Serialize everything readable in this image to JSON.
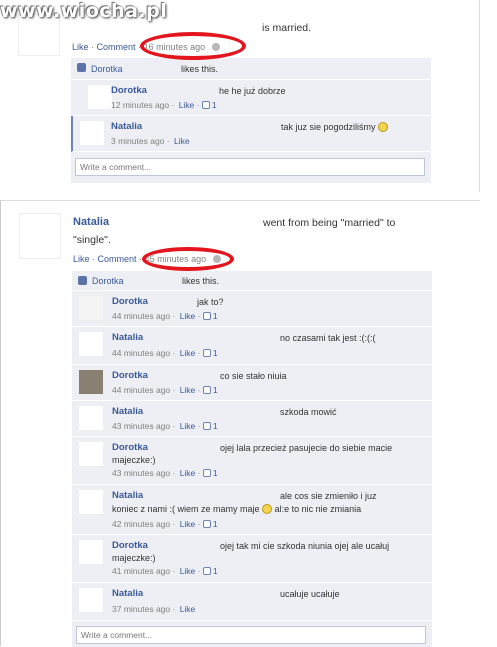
{
  "watermark": "www.wiocha.pl",
  "post1": {
    "action": "is married.",
    "actions": {
      "like": "Like",
      "comment": "Comment",
      "time": "16 minutes ago"
    },
    "likes_name": "Dorotka",
    "likes_text": "likes this.",
    "comments": [
      {
        "name": "Dorotka",
        "text": "he he już dobrze",
        "time": "12 minutes ago",
        "like": "Like",
        "count": "1"
      },
      {
        "name": "Natalia",
        "text": "tak juz sie pogodziliśmy",
        "time": "3 minutes ago",
        "like": "Like"
      }
    ],
    "write_placeholder": "Write a comment..."
  },
  "post2": {
    "name": "Natalia",
    "action_line1": "went from being \"married\" to",
    "action_line2": "\"single\".",
    "actions": {
      "like": "Like",
      "comment": "Comment",
      "time": "45 minutes ago"
    },
    "likes_name": "Dorotka",
    "likes_text": "likes this.",
    "comments": [
      {
        "name": "Dorotka",
        "text": "jak to?",
        "time": "44 minutes ago",
        "like": "Like",
        "count": "1"
      },
      {
        "name": "Natalia",
        "text": "no czasami tak jest :(:(:(",
        "time": "44 minutes ago",
        "like": "Like",
        "count": "1"
      },
      {
        "name": "Dorotka",
        "text": "co sie stało niuia",
        "time": "44 minutes ago",
        "like": "Like",
        "count": "1"
      },
      {
        "name": "Natalia",
        "text": "szkoda mowić",
        "time": "43 minutes ago",
        "like": "Like",
        "count": "1"
      },
      {
        "name": "Dorotka",
        "text": "ojej lala przecież pasujecie do siebie macie",
        "text2": "majeczke:)",
        "time": "43 minutes ago",
        "like": "Like",
        "count": "1"
      },
      {
        "name": "Natalia",
        "text": "ale cos sie zmieniło i juz",
        "text2a": "koniec z nami :( wiem ze mamy maje",
        "text2b": "al:e to nic nie zmiania",
        "time": "42 minutes ago",
        "like": "Like",
        "count": "1"
      },
      {
        "name": "Dorotka",
        "text": "ojej tak mi cie szkoda niunia ojej ale ucałuj",
        "text2": "majeczke:)",
        "time": "41 minutes ago",
        "like": "Like",
        "count": "1"
      },
      {
        "name": "Natalia",
        "text": "ucałuje ucałuje",
        "time": "37 minutes ago",
        "like": "Like"
      }
    ],
    "write_placeholder": "Write a comment..."
  },
  "colors": {
    "link": "#3b5998",
    "highlight": "#e3151d",
    "comment_bg": "#edeff4"
  }
}
